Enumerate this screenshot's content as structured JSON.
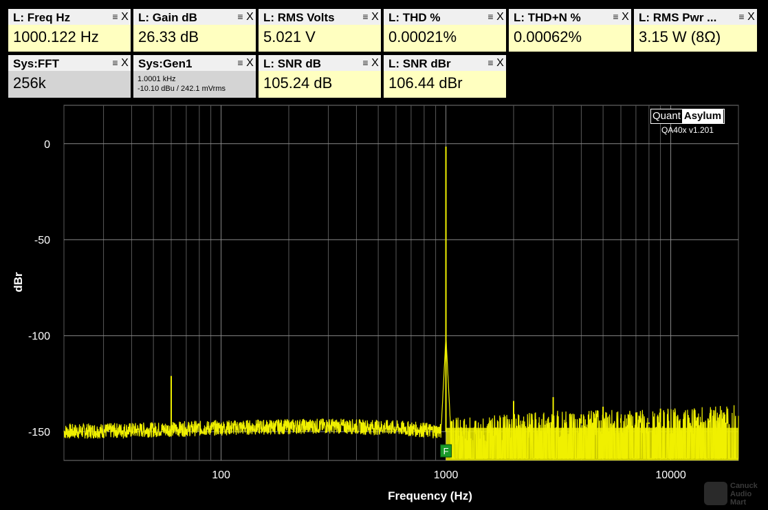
{
  "widgets_row1": [
    {
      "title": "L: Freq Hz",
      "value": "1000.122 Hz"
    },
    {
      "title": "L: Gain dB",
      "value": "26.33 dB"
    },
    {
      "title": "L: RMS Volts",
      "value": "5.021 V"
    },
    {
      "title": "L: THD %",
      "value": "0.00021%"
    },
    {
      "title": "L: THD+N %",
      "value": "0.00062%"
    },
    {
      "title": "L: RMS Pwr ...",
      "value": "3.15 W (8Ω)"
    }
  ],
  "widgets_row2": [
    {
      "title": "Sys:FFT",
      "value": "256k",
      "sys": true
    },
    {
      "title": "Sys:Gen1",
      "line1": "1.0001 kHz",
      "line2": "-10.10 dBu  / 242.1 mVrms",
      "sys": true
    },
    {
      "title": "L: SNR dB",
      "value": "105.24 dB"
    },
    {
      "title": "L: SNR dBr",
      "value": "106.44 dBr"
    }
  ],
  "widget_controls": {
    "menu_glyph": "≡",
    "close_glyph": "X"
  },
  "logo": {
    "left": "Quant",
    "right": "Asylum",
    "version": "QA40x v1.201"
  },
  "watermark": {
    "l1": "Canuck",
    "l2": "Audio",
    "l3": "Mart"
  },
  "colors": {
    "trace": "#f0f000",
    "marker": "#1a9a2a",
    "grid": "#5a5a5a",
    "background": "#000000"
  },
  "chart_data": {
    "type": "line",
    "xlabel": "Frequency (Hz)",
    "ylabel": "dBr",
    "x_scale": "log",
    "xlim": [
      20,
      20000
    ],
    "ylim": [
      -165,
      20
    ],
    "x_ticks": [
      100,
      1000,
      10000
    ],
    "x_tick_labels": [
      "100",
      "1000",
      "10000"
    ],
    "y_ticks": [
      0,
      -50,
      -100,
      -150
    ],
    "y_tick_labels": [
      "0",
      "-50",
      "-100",
      "-150"
    ],
    "grid": true,
    "marker": {
      "x": 1000,
      "y": -160,
      "label": "F"
    },
    "noise_floor": [
      {
        "x": 20,
        "y": -150
      },
      {
        "x": 50,
        "y": -149
      },
      {
        "x": 100,
        "y": -148
      },
      {
        "x": 300,
        "y": -147
      },
      {
        "x": 600,
        "y": -148
      },
      {
        "x": 1000,
        "y": -150
      },
      {
        "x": 3000,
        "y": -146
      },
      {
        "x": 10000,
        "y": -145
      },
      {
        "x": 20000,
        "y": -143
      }
    ],
    "peaks": [
      {
        "x": 60,
        "y": -121
      },
      {
        "x": 1000,
        "y": -1.5
      },
      {
        "x": 2000,
        "y": -134
      },
      {
        "x": 3000,
        "y": -132
      },
      {
        "x": 4000,
        "y": -141
      },
      {
        "x": 5000,
        "y": -137
      },
      {
        "x": 6000,
        "y": -143
      },
      {
        "x": 7000,
        "y": -140
      },
      {
        "x": 8000,
        "y": -146
      },
      {
        "x": 9000,
        "y": -138
      },
      {
        "x": 11000,
        "y": -145
      },
      {
        "x": 12000,
        "y": -143
      },
      {
        "x": 13000,
        "y": -147
      },
      {
        "x": 15000,
        "y": -145
      }
    ]
  }
}
